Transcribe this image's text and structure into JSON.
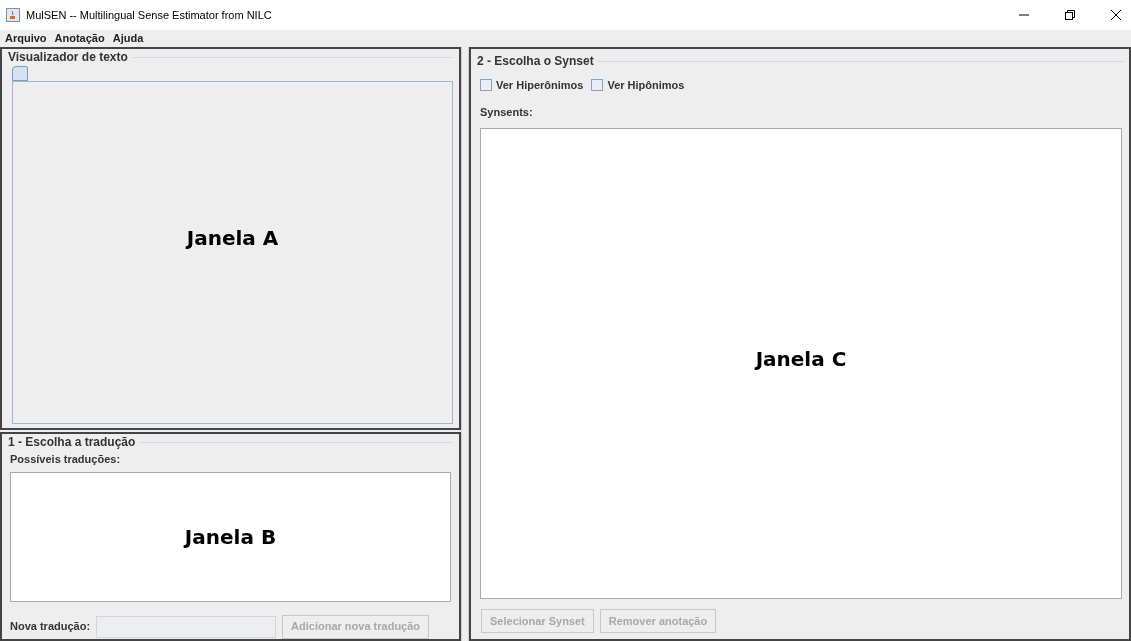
{
  "window": {
    "title": "MulSEN -- Multilingual Sense Estimator from NILC"
  },
  "menu": [
    "Arquivo",
    "Anotação",
    "Ajuda"
  ],
  "text_viewer": {
    "title": "Visualizador de texto",
    "label": "Janela A"
  },
  "translation": {
    "title": "1 - Escolha a tradução",
    "list_label": "Possíveis traduções:",
    "label": "Janela B",
    "new_label": "Nova tradução:",
    "add_button": {
      "label": "Adicionar nova tradução",
      "disabled": true
    }
  },
  "synset": {
    "title": "2 - Escolha o Synset",
    "checkboxes": [
      {
        "label": "Ver Hiperônimos",
        "checked": false
      },
      {
        "label": "Ver Hipônimos",
        "checked": false
      }
    ],
    "list_label": "Synsents:",
    "label": "Janela C",
    "buttons": [
      {
        "label": "Selecionar Synset",
        "disabled": true
      },
      {
        "label": "Remover anotação",
        "disabled": true
      }
    ]
  }
}
